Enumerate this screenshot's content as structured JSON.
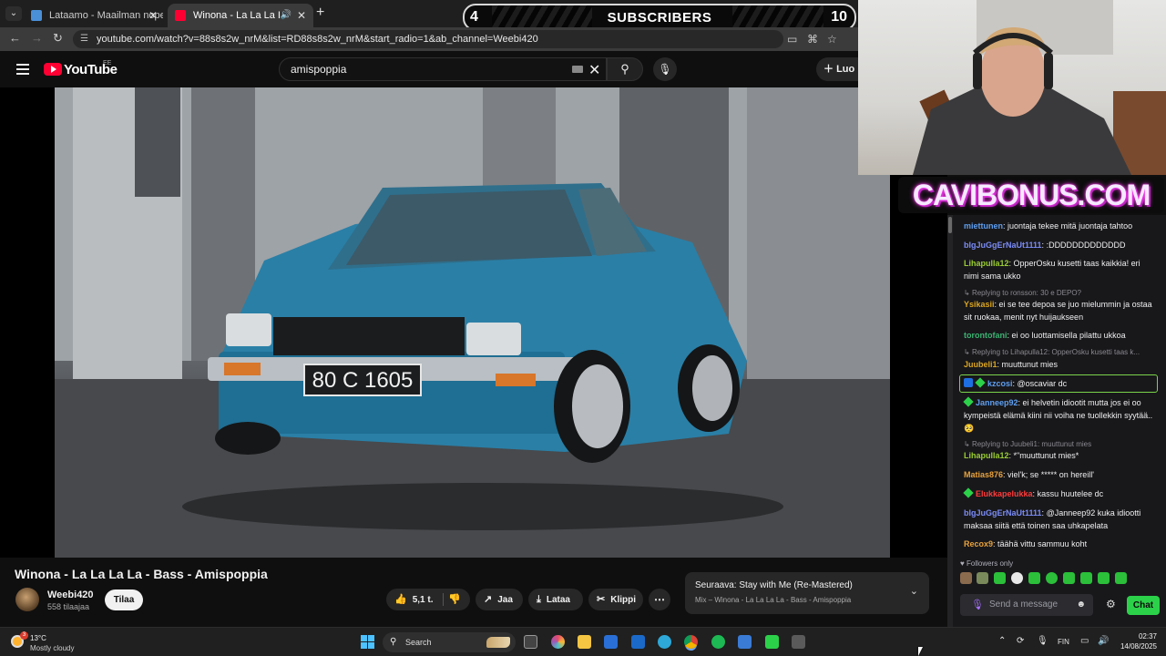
{
  "browser": {
    "tabs": [
      {
        "title": "Lataamo - Maailman nopein ka"
      },
      {
        "title": "Winona - La La La La - Bass"
      }
    ],
    "url": "youtube.com/watch?v=88s8s2w_nrM&list=RD88s8s2w_nrM&start_radio=1&ab_channel=Weebi420"
  },
  "subscriber_goal": {
    "current": "4",
    "label": "SUBSCRIBERS",
    "target": "10"
  },
  "youtube": {
    "logo_text": "YouTube",
    "region": "EE",
    "search_value": "amispoppia",
    "create_label": "Luo",
    "video": {
      "plate": "80 C 1605"
    },
    "title": "Winona - La La La La - Bass - Amispoppia",
    "channel": {
      "name": "Weebi420",
      "subscribers": "558 tilaajaa",
      "subscribe_label": "Tilaa"
    },
    "actions": {
      "likes": "5,1 t.",
      "share": "Jaa",
      "download": "Lataa",
      "clip": "Klippi"
    },
    "up_next": {
      "prefix": "Seuraava:",
      "title": "Stay with Me (Re-Mastered)",
      "playlist": "Mix – Winona - La La La La - Bass - Amispoppia"
    }
  },
  "overlay": {
    "brand": "CAVIBONUS.COM"
  },
  "chat": {
    "messages": [
      {
        "user": "miettunen",
        "color": "#5f9ff0",
        "text": "juontaja tekee mitä juontaja tahtoo"
      },
      {
        "user": "bIgJuGgErNaUt1111",
        "color": "#7b8cf5",
        "text": ":DDDDDDDDDDDDD"
      },
      {
        "user": "Lihapulla12",
        "color": "#9acd32",
        "text": "OpperOsku kusetti taas kaikkia! eri nimi sama ukko"
      },
      {
        "reply": "Replying to ronsson: 30 e DEPO?"
      },
      {
        "user": "Ysikasii",
        "color": "#daa520",
        "text": "ei se tee depoa se juo mielummin ja ostaa sit ruokaa, menit nyt huijaukseen"
      },
      {
        "user": "torontofani",
        "color": "#3cb371",
        "text": "ei oo luottamisella pilattu ukkoa"
      },
      {
        "reply": "Replying to Lihapulla12: OpperOsku kusetti taas k..."
      },
      {
        "user": "Juubeli1",
        "color": "#daa520",
        "text": "muuttunut mies"
      },
      {
        "user": "kzcosi",
        "color": "#5f9ff0",
        "text": "@oscaviar dc"
      },
      {
        "user": "Janneep92",
        "color": "#5f9ff0",
        "text": "ei helvetin idiootit mutta jos ei oo kympeistä elämä kiini nii voiha ne tuollekkin syytää.. 🥺"
      },
      {
        "reply": "Replying to Juubeli1: muuttunut mies"
      },
      {
        "user": "Lihapulla12",
        "color": "#9acd32",
        "text": "*\"muuttunut mies*"
      },
      {
        "user": "Matias876",
        "color": "#e8a23c",
        "text": "viel'k; se ***** on hereill'"
      },
      {
        "user": "Elukkapelukka",
        "color": "#ff3b3b",
        "text": "kassu huutelee dc"
      },
      {
        "user": "bIgJuGgErNaUt1111",
        "color": "#7b8cf5",
        "text": "@Janneep92 kuka idiootti maksaa siitä että toinen saa uhkapelata"
      },
      {
        "user": "Recox9",
        "color": "#e8a23c",
        "text": "täähä vittu sammuu koht"
      }
    ],
    "followers_only": "Followers only",
    "input_placeholder": "Send a message",
    "send_label": "Chat"
  },
  "taskbar": {
    "temperature": "13°C",
    "condition": "Mostly cloudy",
    "notification_count": "3",
    "search_label": "Search",
    "language": "FIN",
    "time": "02:37",
    "date": "14/08/2025"
  }
}
